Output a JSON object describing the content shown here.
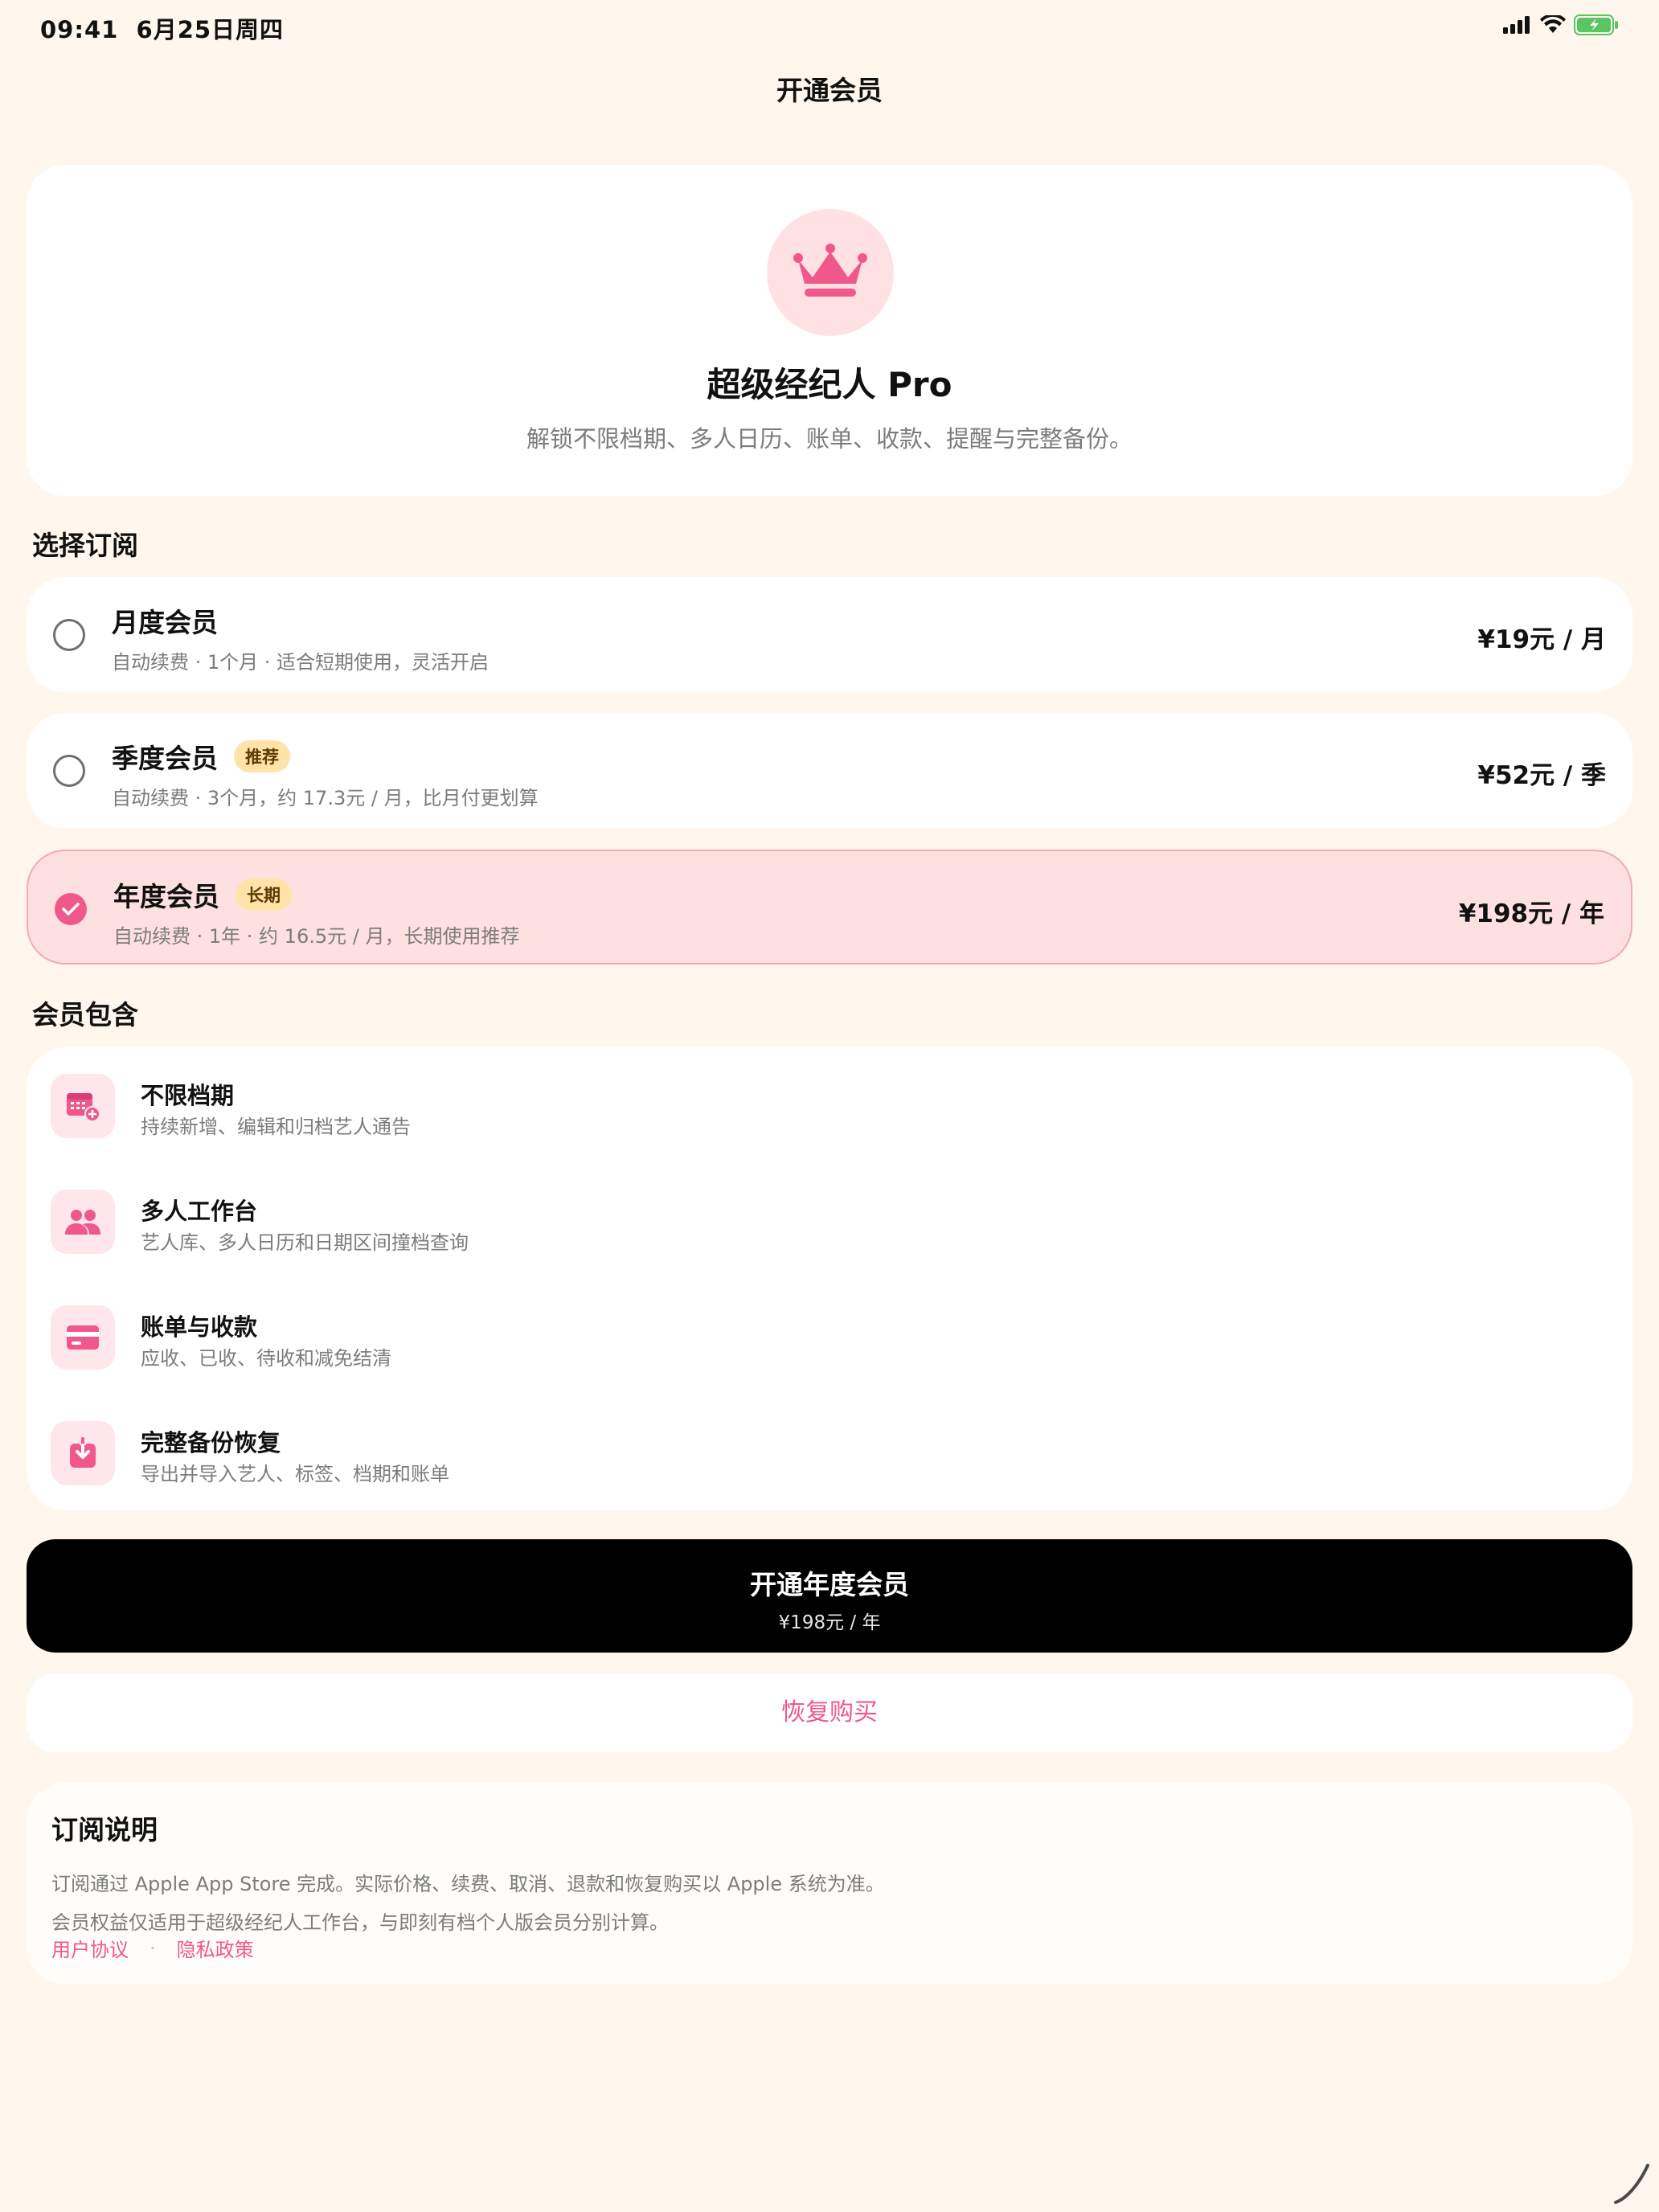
{
  "status_bar": {
    "time": "09:41",
    "date": "6月25日周四",
    "battery_charging": true
  },
  "nav": {
    "title": "开通会员"
  },
  "hero": {
    "title": "超级经纪人 Pro",
    "subtitle": "解锁不限档期、多人日历、账单、收款、提醒与完整备份。",
    "icon": "crown-icon"
  },
  "plans_section": {
    "title": "选择订阅"
  },
  "plans": [
    {
      "name": "月度会员",
      "tag": "",
      "desc": "自动续费 · 1个月 · 适合短期使用，灵活开启",
      "price": "¥19元 / 月",
      "selected": false
    },
    {
      "name": "季度会员",
      "tag": "推荐",
      "desc": "自动续费 · 3个月，约 17.3元 / 月，比月付更划算",
      "price": "¥52元 / 季",
      "selected": false
    },
    {
      "name": "年度会员",
      "tag": "长期",
      "desc": "自动续费 · 1年 · 约 16.5元 / 月，长期使用推荐",
      "price": "¥198元 / 年",
      "selected": true
    }
  ],
  "features_section": {
    "title": "会员包含"
  },
  "features": [
    {
      "icon": "calendar-add-icon",
      "title": "不限档期",
      "desc": "持续新增、编辑和归档艺人通告"
    },
    {
      "icon": "people-icon",
      "title": "多人工作台",
      "desc": "艺人库、多人日历和日期区间撞档查询"
    },
    {
      "icon": "card-icon",
      "title": "账单与收款",
      "desc": "应收、已收、待收和减免结清"
    },
    {
      "icon": "download-box-icon",
      "title": "完整备份恢复",
      "desc": "导出并导入艺人、标签、档期和账单"
    }
  ],
  "cta": {
    "title": "开通年度会员",
    "subtitle": "¥198元 / 年"
  },
  "restore": {
    "label": "恢复购买"
  },
  "notes": {
    "title": "订阅说明",
    "line1": "订阅通过 Apple App Store 完成。实际价格、续费、取消、退款和恢复购买以 Apple 系统为准。",
    "line2": "会员权益仅适用于超级经纪人工作台，与即刻有档个人版会员分别计算。",
    "link_terms": "用户协议",
    "separator": "·",
    "link_privacy": "隐私政策"
  },
  "colors": {
    "accent": "#F0588C",
    "background": "#FFF7EE",
    "selected_bg": "#FFE0E1",
    "tag_bg": "#FFE3A8"
  }
}
